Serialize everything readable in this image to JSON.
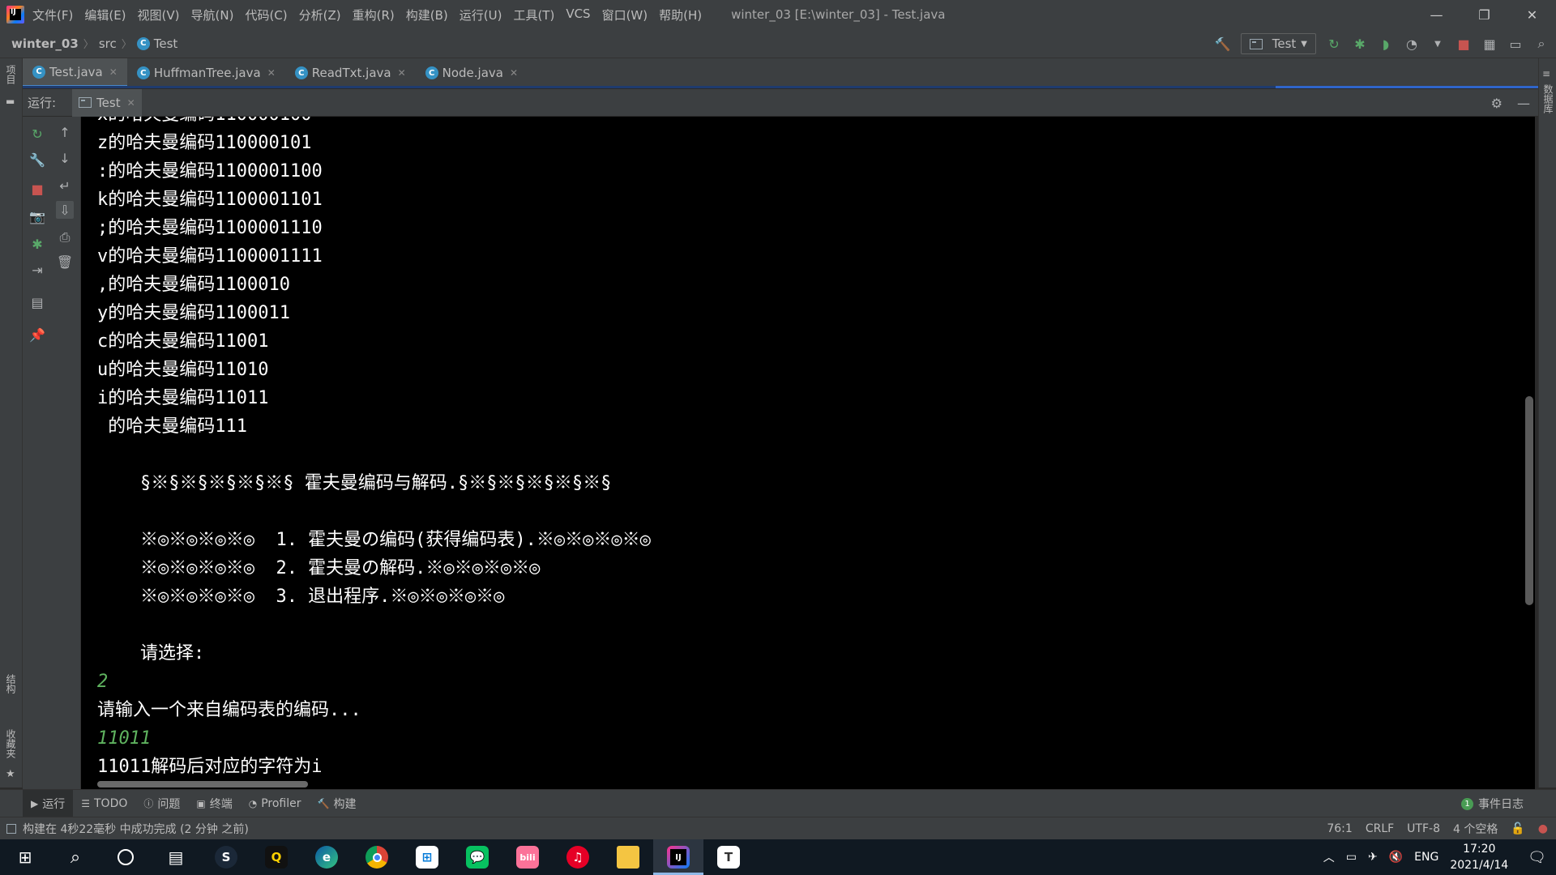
{
  "menu": {
    "items": [
      "文件(F)",
      "编辑(E)",
      "视图(V)",
      "导航(N)",
      "代码(C)",
      "分析(Z)",
      "重构(R)",
      "构建(B)",
      "运行(U)",
      "工具(T)",
      "VCS",
      "窗口(W)",
      "帮助(H)"
    ],
    "window_title": "winter_03 [E:\\winter_03] - Test.java"
  },
  "breadcrumb": {
    "project": "winter_03",
    "folder": "src",
    "file": "Test"
  },
  "run_config": {
    "label": "Test"
  },
  "left_strip": {
    "project_label": "项目",
    "structure_label": "结构",
    "favorites_label": "收藏夹"
  },
  "right_strip": {
    "database_label": "数据库"
  },
  "editor_tabs": [
    {
      "label": "Test.java",
      "active": true
    },
    {
      "label": "HuffmanTree.java",
      "active": false
    },
    {
      "label": "ReadTxt.java",
      "active": false
    },
    {
      "label": "Node.java",
      "active": false
    }
  ],
  "run_window": {
    "label": "运行:",
    "tab": "Test"
  },
  "console": {
    "lines": [
      {
        "text": "z的哈夫曼编码110000101",
        "type": "out"
      },
      {
        "text": ":的哈夫曼编码1100001100",
        "type": "out"
      },
      {
        "text": "k的哈夫曼编码1100001101",
        "type": "out"
      },
      {
        "text": ";的哈夫曼编码1100001110",
        "type": "out"
      },
      {
        "text": "v的哈夫曼编码1100001111",
        "type": "out"
      },
      {
        "text": ",的哈夫曼编码1100010",
        "type": "out"
      },
      {
        "text": "y的哈夫曼编码1100011",
        "type": "out"
      },
      {
        "text": "c的哈夫曼编码11001",
        "type": "out"
      },
      {
        "text": "u的哈夫曼编码11010",
        "type": "out"
      },
      {
        "text": "i的哈夫曼编码11011",
        "type": "out"
      },
      {
        "text": " 的哈夫曼编码111",
        "type": "out"
      },
      {
        "text": "",
        "type": "out"
      },
      {
        "text": "    §※§※§※§※§※§ 霍夫曼编码与解码.§※§※§※§※§※§",
        "type": "out"
      },
      {
        "text": "",
        "type": "out"
      },
      {
        "text": "    ※◎※◎※◎※◎  1. 霍夫曼の编码(获得编码表).※◎※◎※◎※◎",
        "type": "out"
      },
      {
        "text": "    ※◎※◎※◎※◎  2. 霍夫曼の解码.※◎※◎※◎※◎",
        "type": "out"
      },
      {
        "text": "    ※◎※◎※◎※◎  3. 退出程序.※◎※◎※◎※◎",
        "type": "out"
      },
      {
        "text": "",
        "type": "out"
      },
      {
        "text": "    请选择:",
        "type": "out"
      },
      {
        "text": "2",
        "type": "input"
      },
      {
        "text": "请输入一个来自编码表的编码...",
        "type": "out"
      },
      {
        "text": "11011",
        "type": "input"
      },
      {
        "text": "11011解码后对应的字符为i",
        "type": "out"
      }
    ]
  },
  "tool_windows": [
    {
      "label": "运行",
      "icon": "play-icon",
      "active": true
    },
    {
      "label": "TODO",
      "icon": "list-icon",
      "active": false
    },
    {
      "label": "问题",
      "icon": "info-icon",
      "active": false
    },
    {
      "label": "终端",
      "icon": "terminal-icon",
      "active": false
    },
    {
      "label": "Profiler",
      "icon": "profiler-icon",
      "active": false
    },
    {
      "label": "构建",
      "icon": "hammer-icon",
      "active": false
    }
  ],
  "event_log": {
    "count": "1",
    "label": "事件日志"
  },
  "status": {
    "message": "构建在 4秒22毫秒 中成功完成 (2 分钟 之前)",
    "position": "76:1",
    "line_sep": "CRLF",
    "encoding": "UTF-8",
    "indent": "4 个空格"
  },
  "taskbar": {
    "tray_lang": "ENG",
    "time": "17:20",
    "date": "2021/4/14"
  },
  "colors": {
    "accent": "#4a88c7",
    "console_bg": "#000000",
    "console_input": "#5fb35f",
    "ide_bg": "#3c3f41"
  }
}
